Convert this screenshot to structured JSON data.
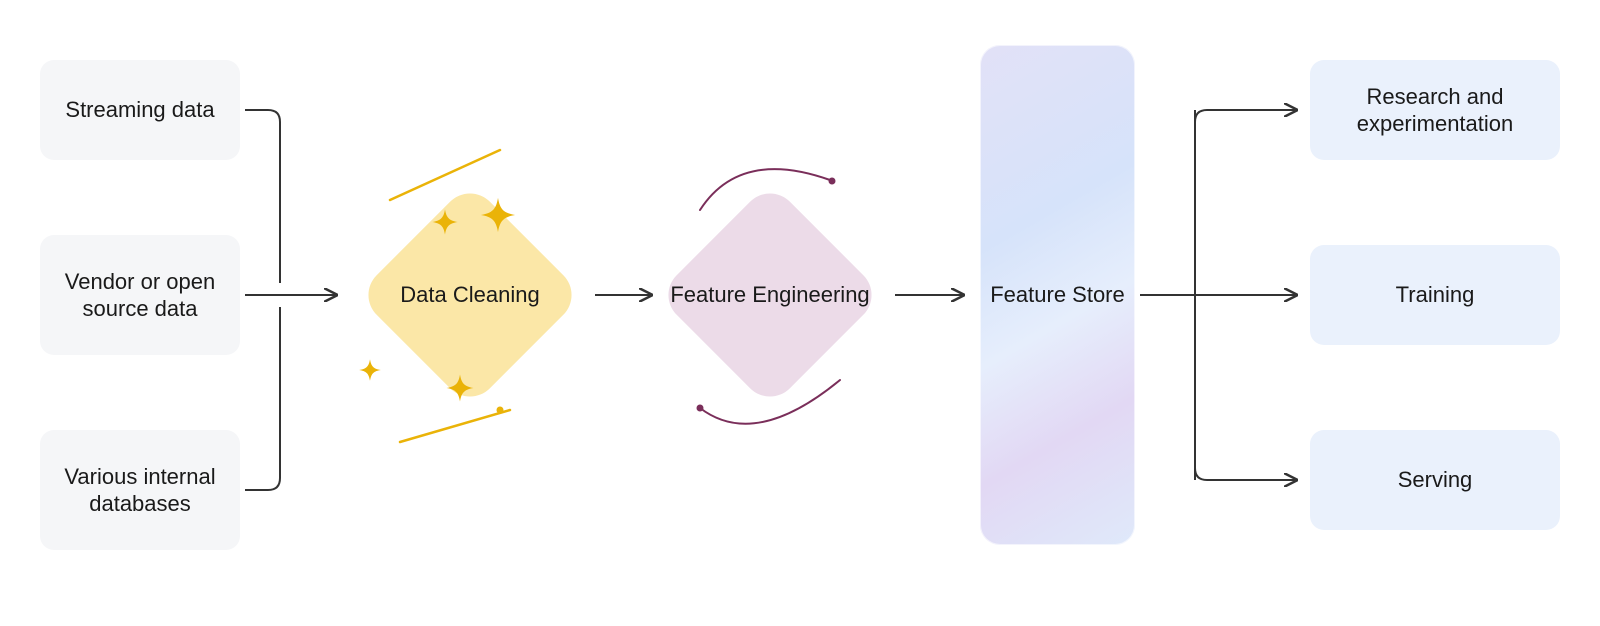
{
  "sources": [
    "Streaming data",
    "Vendor or open source data",
    "Various internal databases"
  ],
  "stages": {
    "data_cleaning": "Data Cleaning",
    "feature_engineering": "Feature Engineering",
    "feature_store": "Feature Store"
  },
  "outputs": [
    "Research and experimentation",
    "Training",
    "Serving"
  ],
  "colors": {
    "source_box": "#f5f6f8",
    "output_box": "#eaf1fc",
    "data_cleaning_diamond": "#fbe7a7",
    "feature_engineering_diamond": "#ecdbe8",
    "feature_store_gradient_start": "#e2e1f7",
    "feature_store_gradient_end": "#dfe9fa",
    "accent_yellow": "#eab308",
    "accent_plum": "#7a2e5a",
    "connector": "#333333"
  }
}
